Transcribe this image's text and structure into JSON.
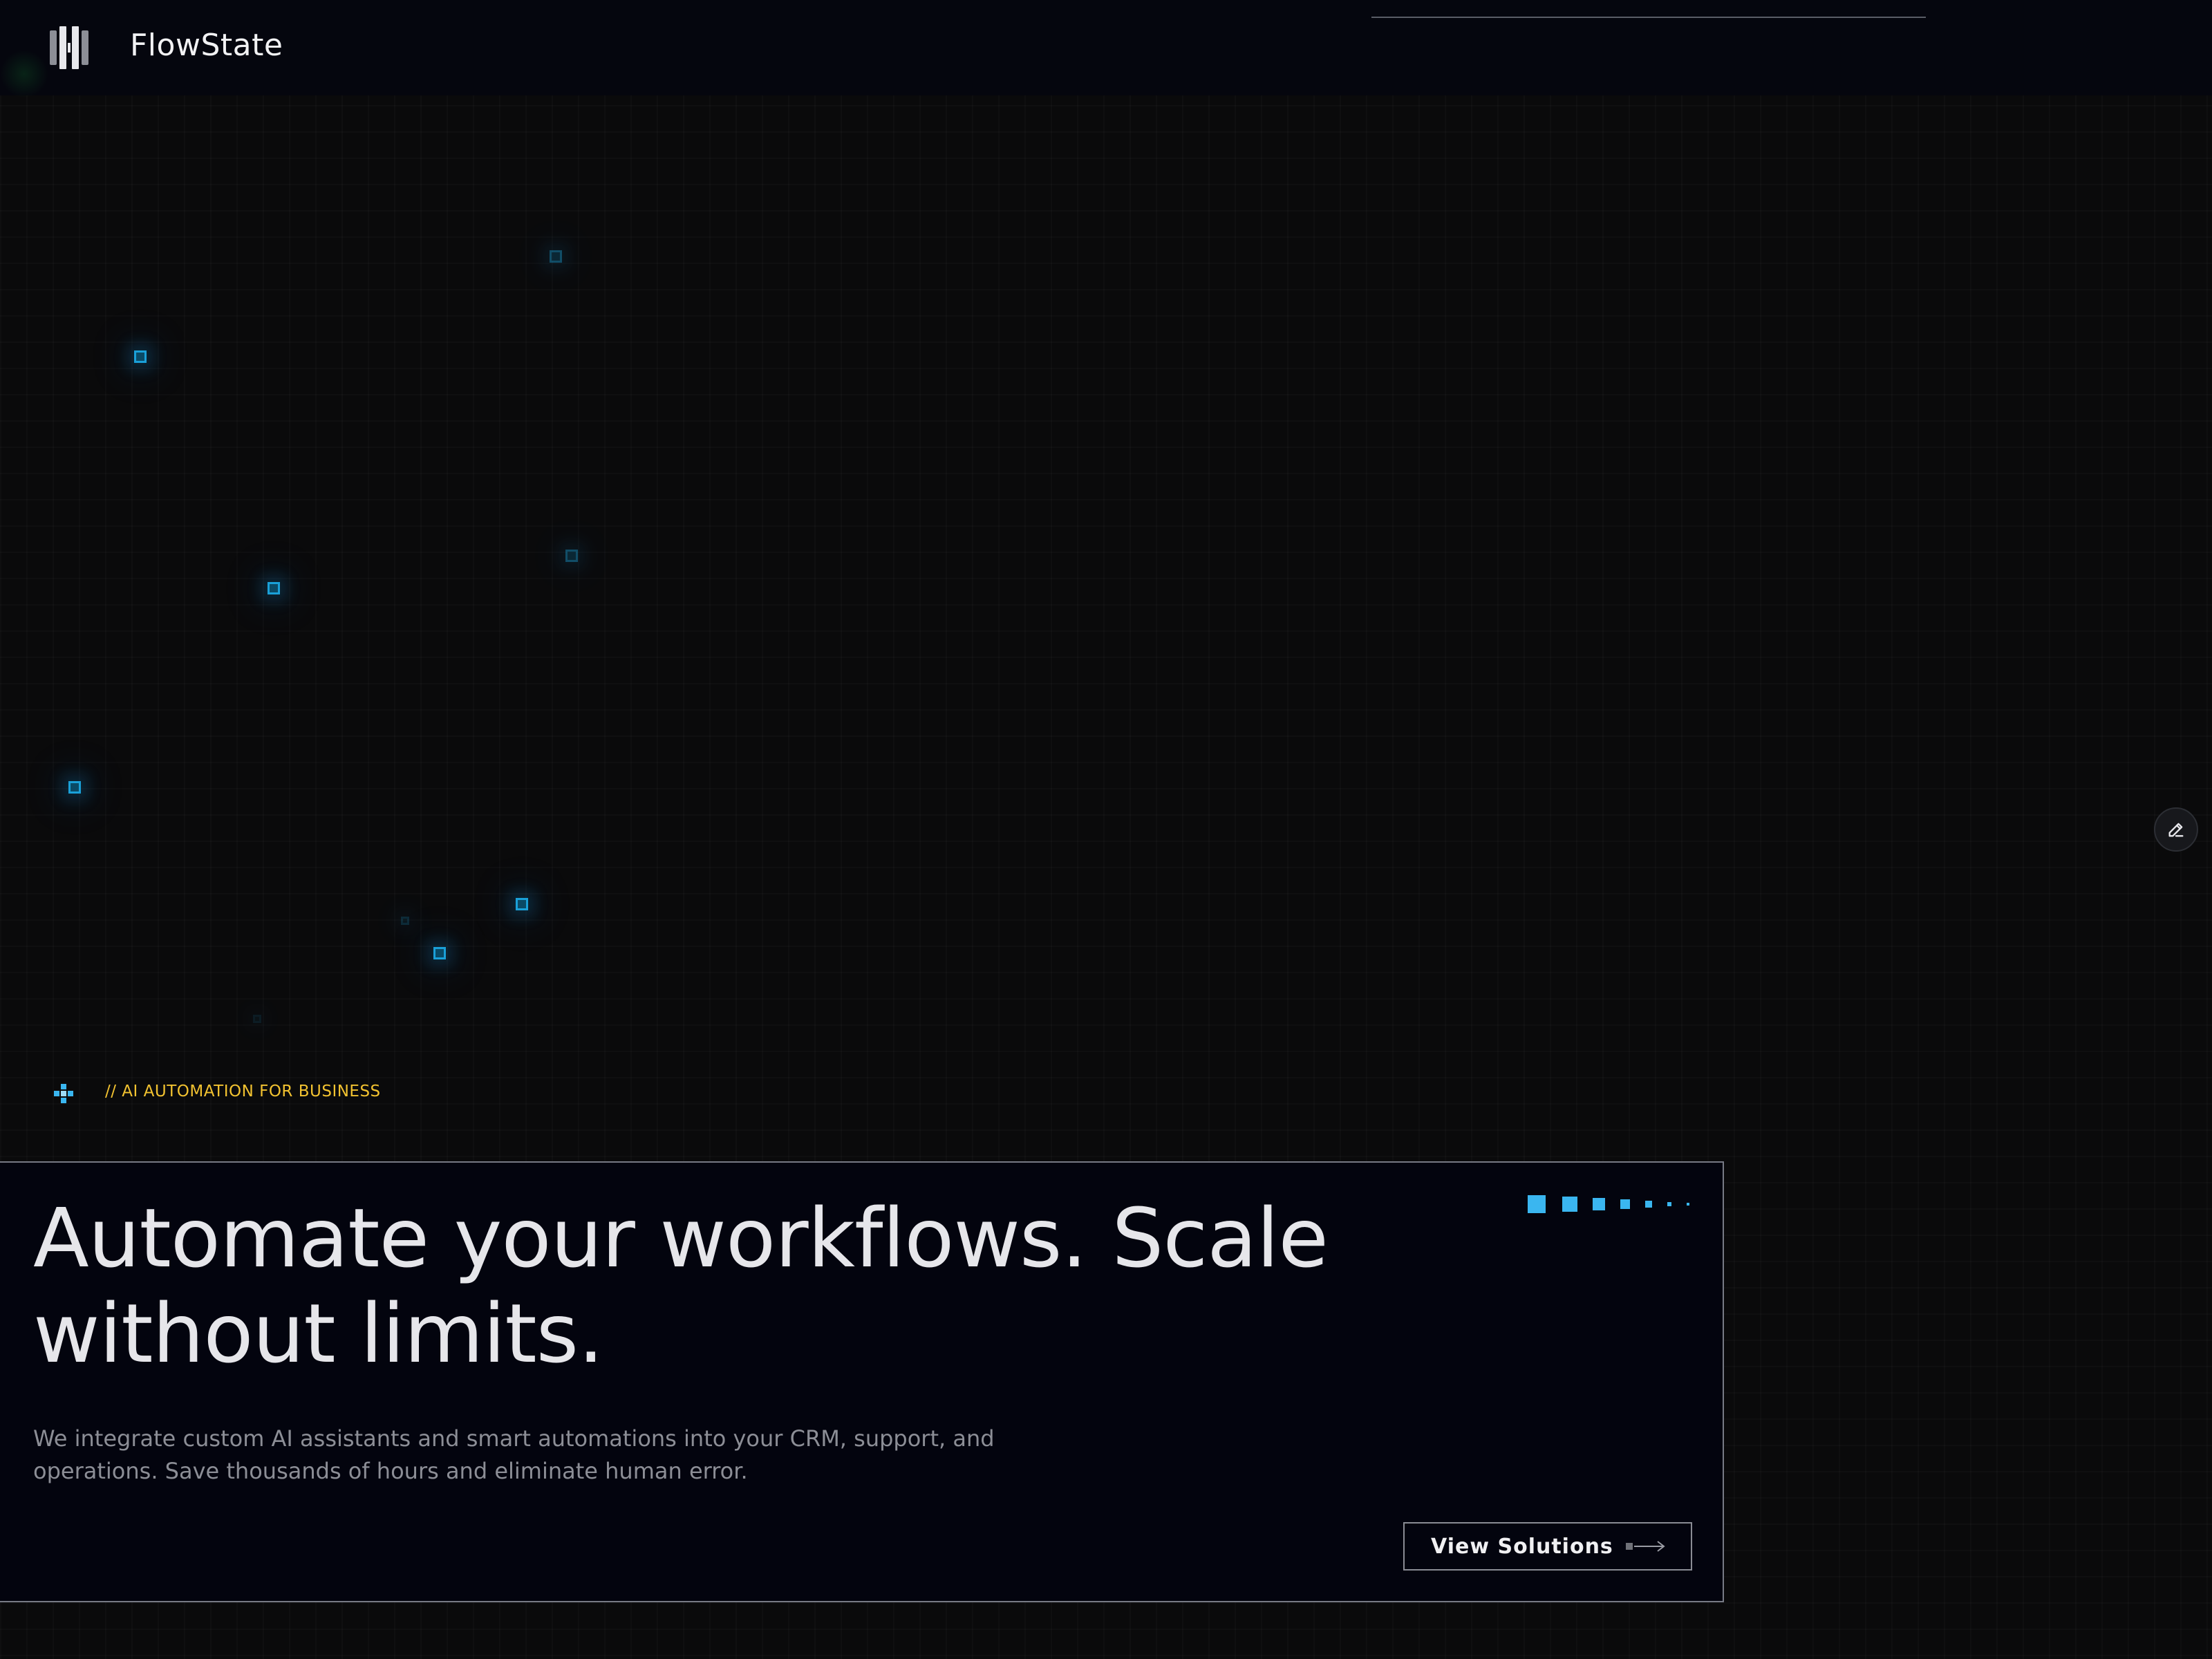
{
  "header": {
    "brand": "FlowState",
    "logo_icon": "columns-logo-icon"
  },
  "hero": {
    "tag_icon": "pixel-cross-icon",
    "tag": "// AI AUTOMATION FOR BUSINESS",
    "headline": "Automate your workflows. Scale without limits.",
    "subtext": "We integrate custom AI assistants and smart automations into your CRM, support, and operations. Save thousands of hours and eliminate human error.",
    "cta_label": "View Solutions",
    "cta_icon": "arrow-right-icon"
  },
  "floating": {
    "edit_icon": "pencil-icon"
  },
  "colors": {
    "background": "#0a0a0b",
    "header_bg": "#05060e",
    "card_bg": "#03040e",
    "accent_blue": "#3ab6f0",
    "tag_yellow": "#f2c230",
    "headline": "#e6e6ea",
    "muted_text": "#8c8e96"
  }
}
